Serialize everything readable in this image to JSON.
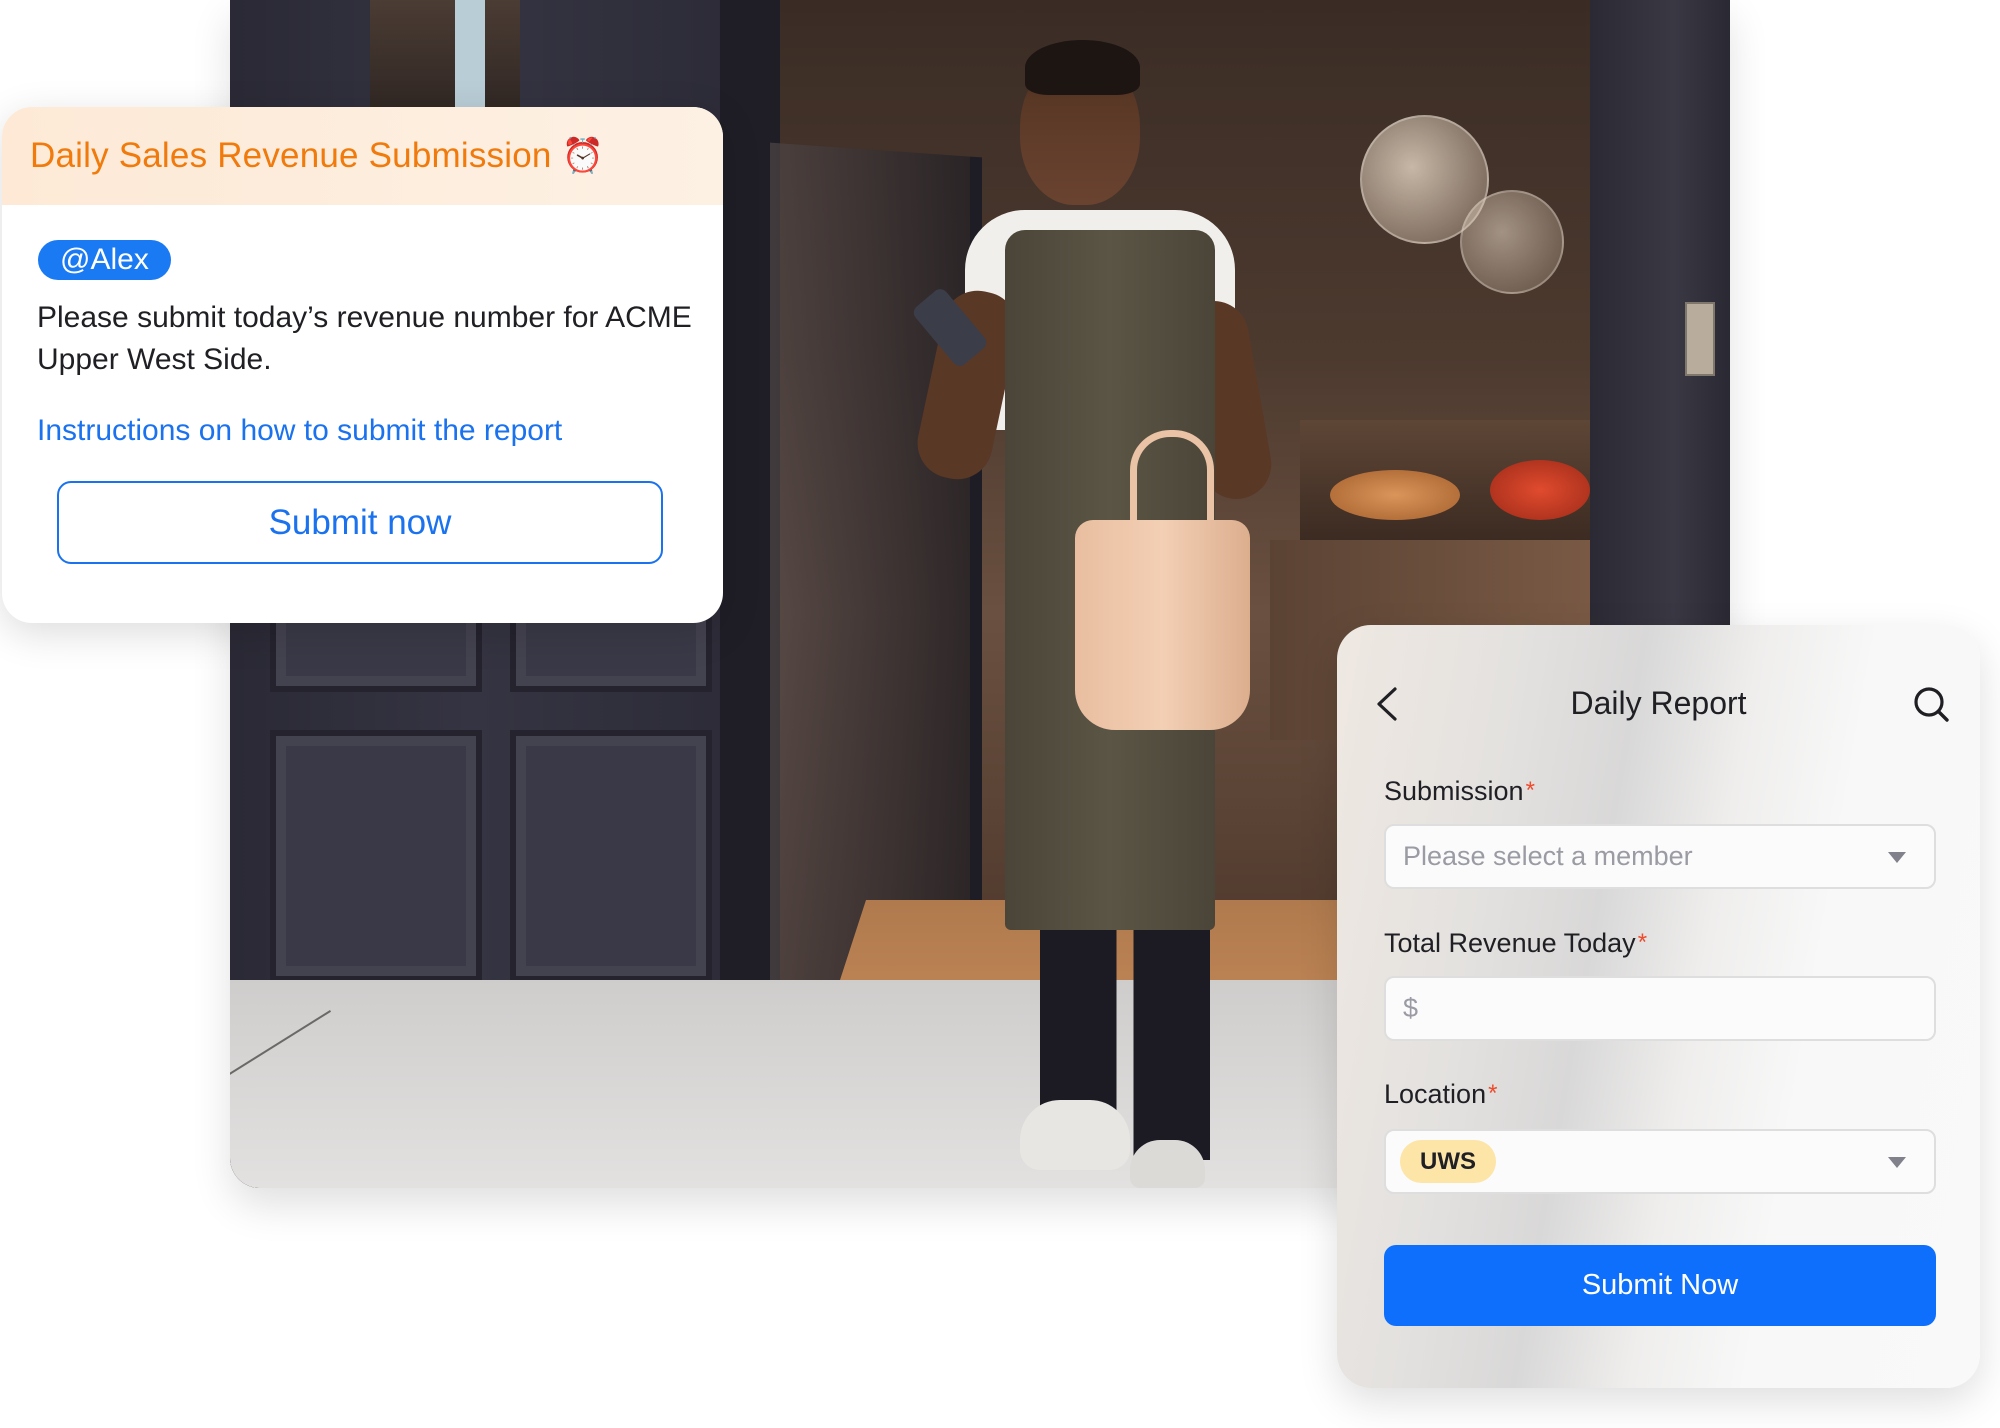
{
  "notification": {
    "title": "Daily Sales Revenue Submission",
    "title_icon": "⏰",
    "mention": "@Alex",
    "message": "Please submit today’s revenue number for ACME Upper West Side.",
    "link_label": "Instructions on how to submit the report",
    "button_label": "Submit now"
  },
  "form": {
    "title": "Daily Report",
    "fields": [
      {
        "label": "Submission",
        "required_mark": "*",
        "type": "select",
        "placeholder": "Please select a member",
        "value": ""
      },
      {
        "label": "Total Revenue Today",
        "required_mark": "*",
        "type": "currency",
        "prefix": "$",
        "value": ""
      },
      {
        "label": "Location",
        "required_mark": "*",
        "type": "select",
        "value": "UWS"
      }
    ],
    "submit_label": "Submit Now"
  },
  "colors": {
    "accent_orange": "#f07a0c",
    "accent_blue": "#1a72ee",
    "primary_button": "#0d6ffb",
    "required_red": "#ee4a2b",
    "location_chip": "#fde5a8"
  },
  "photo": {
    "description": "Shop worker in apron holding phone and tote bag at storefront entrance"
  }
}
